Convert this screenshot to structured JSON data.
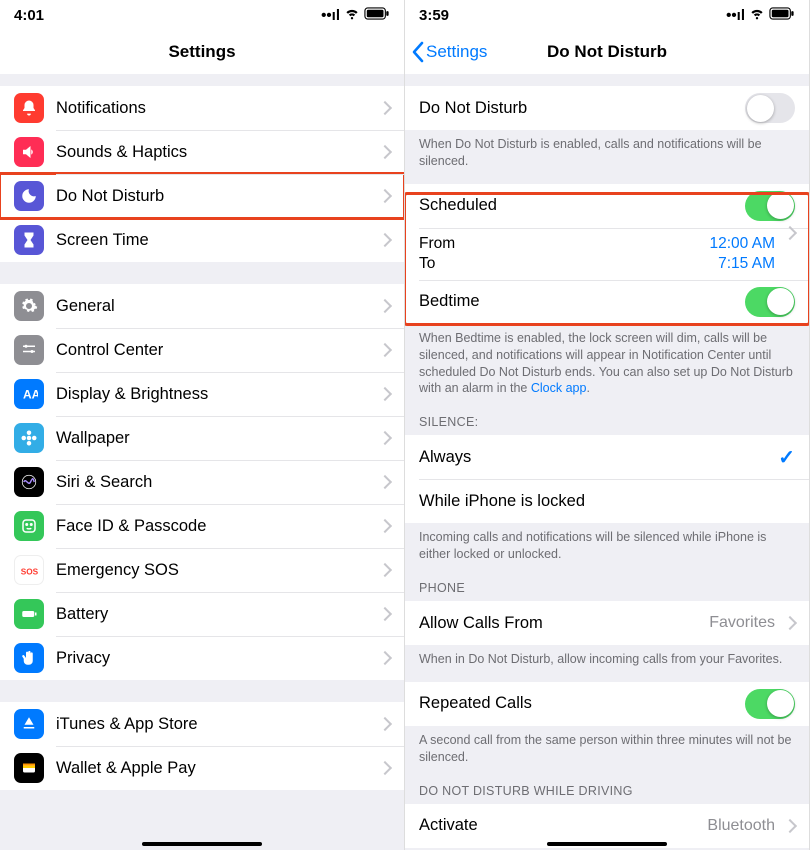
{
  "left": {
    "time": "4:01",
    "title": "Settings",
    "groups": [
      [
        {
          "name": "notifications",
          "label": "Notifications",
          "iconClass": "ic-red",
          "icon": "bell"
        },
        {
          "name": "sounds-haptics",
          "label": "Sounds & Haptics",
          "iconClass": "ic-pink",
          "icon": "speaker"
        },
        {
          "name": "do-not-disturb",
          "label": "Do Not Disturb",
          "iconClass": "ic-indigo",
          "icon": "moon",
          "highlight": true
        },
        {
          "name": "screen-time",
          "label": "Screen Time",
          "iconClass": "ic-indigo",
          "icon": "hourglass"
        }
      ],
      [
        {
          "name": "general",
          "label": "General",
          "iconClass": "ic-gray",
          "icon": "gear"
        },
        {
          "name": "control-center",
          "label": "Control Center",
          "iconClass": "ic-gray",
          "icon": "sliders"
        },
        {
          "name": "display-brightness",
          "label": "Display & Brightness",
          "iconClass": "ic-blue",
          "icon": "text"
        },
        {
          "name": "wallpaper",
          "label": "Wallpaper",
          "iconClass": "ic-cyan",
          "icon": "flower"
        },
        {
          "name": "siri-search",
          "label": "Siri & Search",
          "iconClass": "ic-black",
          "icon": "siri"
        },
        {
          "name": "face-id",
          "label": "Face ID & Passcode",
          "iconClass": "ic-green",
          "icon": "face"
        },
        {
          "name": "emergency-sos",
          "label": "Emergency SOS",
          "iconClass": "ic-white",
          "icon": "sos"
        },
        {
          "name": "battery",
          "label": "Battery",
          "iconClass": "ic-green",
          "icon": "batt"
        },
        {
          "name": "privacy",
          "label": "Privacy",
          "iconClass": "ic-blue",
          "icon": "hand"
        }
      ],
      [
        {
          "name": "itunes",
          "label": "iTunes & App Store",
          "iconClass": "ic-blue",
          "icon": "appstore"
        },
        {
          "name": "wallet",
          "label": "Wallet & Apple Pay",
          "iconClass": "ic-black",
          "icon": "wallet"
        }
      ]
    ]
  },
  "right": {
    "time": "3:59",
    "back": "Settings",
    "title": "Do Not Disturb",
    "dnd_label": "Do Not Disturb",
    "dnd_on": false,
    "dnd_footer": "When Do Not Disturb is enabled, calls and notifications will be silenced.",
    "scheduled_label": "Scheduled",
    "scheduled_on": true,
    "from_label": "From",
    "to_label": "To",
    "from_value": "12:00 AM",
    "to_value": "7:15 AM",
    "bedtime_label": "Bedtime",
    "bedtime_on": true,
    "bedtime_footer_1": "When Bedtime is enabled, the lock screen will dim, calls will be silenced, and notifications will appear in Notification Center until scheduled Do Not Disturb ends. You can also set up Do Not Disturb with an alarm in the ",
    "bedtime_footer_link": "Clock app",
    "bedtime_footer_2": ".",
    "silence_header": "SILENCE:",
    "silence_always": "Always",
    "silence_locked": "While iPhone is locked",
    "silence_footer": "Incoming calls and notifications will be silenced while iPhone is either locked or unlocked.",
    "phone_header": "PHONE",
    "allow_calls_label": "Allow Calls From",
    "allow_calls_value": "Favorites",
    "allow_calls_footer": "When in Do Not Disturb, allow incoming calls from your Favorites.",
    "repeated_label": "Repeated Calls",
    "repeated_on": true,
    "repeated_footer": "A second call from the same person within three minutes will not be silenced.",
    "driving_header": "DO NOT DISTURB WHILE DRIVING",
    "activate_label": "Activate",
    "activate_value": "Bluetooth"
  }
}
